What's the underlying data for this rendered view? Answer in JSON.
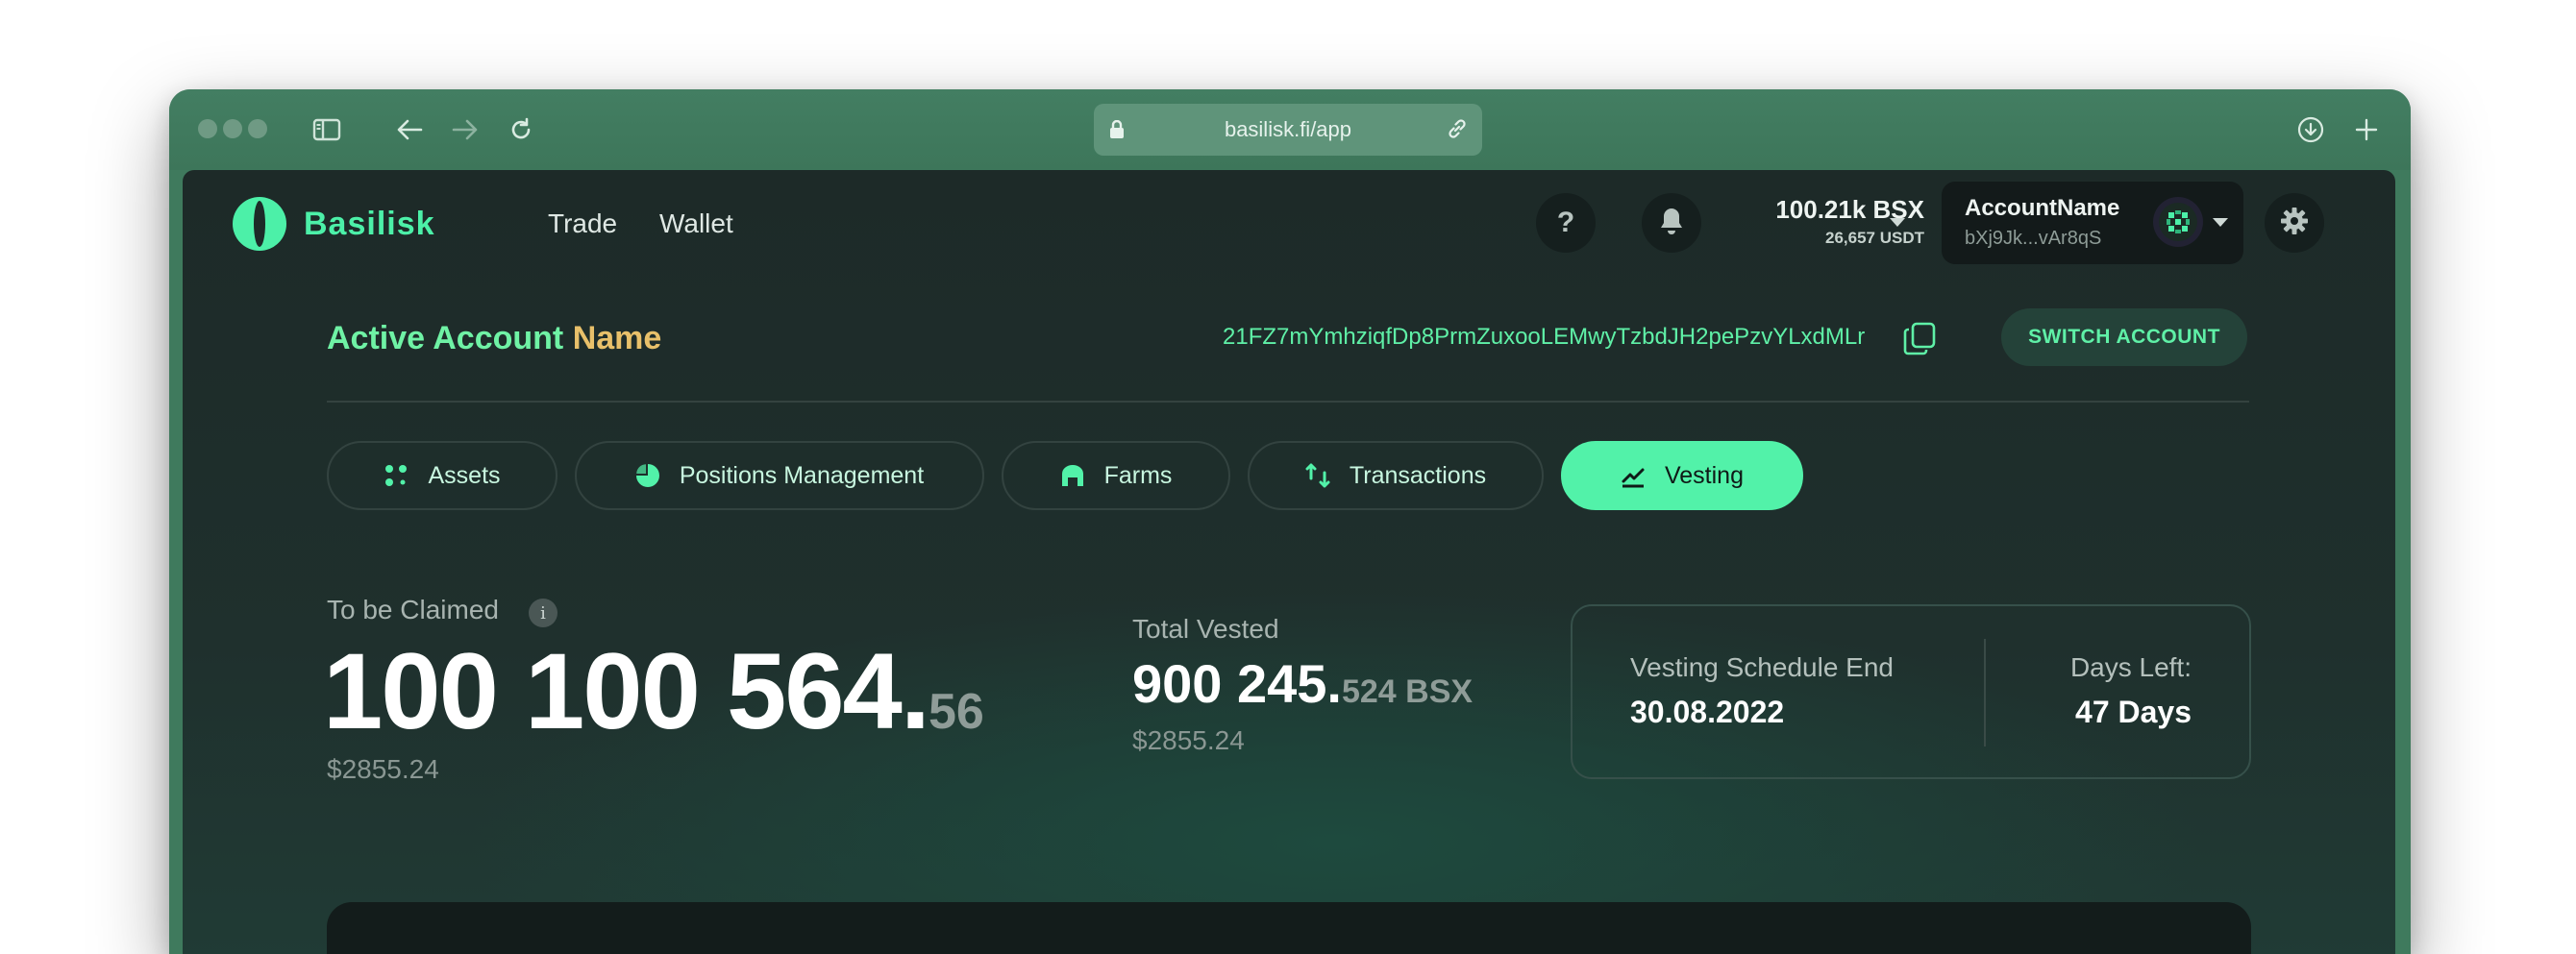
{
  "browser": {
    "url": "basilisk.fi/app"
  },
  "nav": {
    "logo_text": "Basilisk",
    "links": [
      "Trade",
      "Wallet"
    ],
    "help_label": "?",
    "balance_main": "100.21k BSX",
    "balance_sub": "26,657 USDT",
    "account_name": "AccountName",
    "account_address": "bXj9Jk...vAr8qS"
  },
  "account": {
    "title_part1": "Active Account",
    "title_part2": "Name",
    "full_address": "21FZ7mYmhziqfDp8PrmZuxooLEMwyTzbdJH2pePzvYLxdMLr",
    "switch_label": "SWITCH ACCOUNT"
  },
  "tabs": [
    {
      "label": "Assets",
      "icon": "dots-icon",
      "active": false
    },
    {
      "label": "Positions Management",
      "icon": "pie-icon",
      "active": false
    },
    {
      "label": "Farms",
      "icon": "farm-icon",
      "active": false
    },
    {
      "label": "Transactions",
      "icon": "transfer-icon",
      "active": false
    },
    {
      "label": "Vesting",
      "icon": "chart-trend-icon",
      "active": true
    }
  ],
  "claim": {
    "label": "To be Claimed",
    "info": "i",
    "whole": "100 100 564.",
    "decimals": "56",
    "usd": "$2855.24"
  },
  "vested": {
    "label": "Total Vested",
    "whole": "900 245.",
    "decimals": "524 BSX",
    "usd": "$2855.24"
  },
  "schedule": {
    "end_label": "Vesting Schedule End",
    "end_value": "30.08.2022",
    "days_label": "Days Left:",
    "days_value": "47 Days"
  },
  "colors": {
    "accent": "#52f2a9",
    "title_yellow": "#e8c06a",
    "background": "#1d2a28",
    "chrome": "#3f7a5d"
  }
}
